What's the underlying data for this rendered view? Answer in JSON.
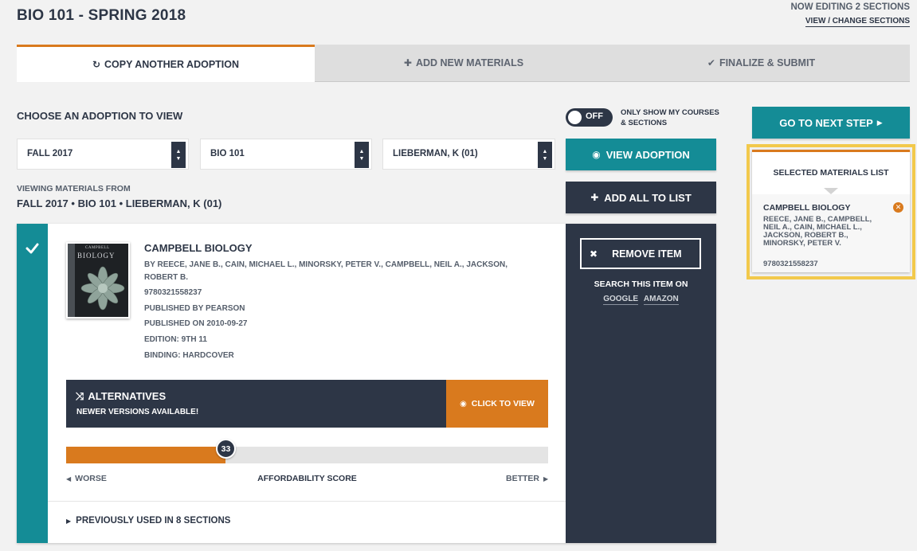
{
  "page": {
    "title": "BIO 101 - SPRING 2018",
    "editing_status": "NOW EDITING 2 SECTIONS",
    "change_sections_link": "VIEW / CHANGE SECTIONS"
  },
  "tabs": [
    {
      "label": "COPY ANOTHER ADOPTION",
      "icon": "refresh-icon",
      "active": true
    },
    {
      "label": "ADD NEW MATERIALS",
      "icon": "plus-icon",
      "active": false
    },
    {
      "label": "FINALIZE & SUBMIT",
      "icon": "check-icon",
      "active": false
    }
  ],
  "chooser": {
    "heading": "CHOOSE AN ADOPTION TO VIEW",
    "toggle_state": "OFF",
    "toggle_label": "ONLY SHOW MY COURSES & SECTIONS",
    "term_select": "FALL 2017",
    "course_select": "BIO 101",
    "instructor_select": "LIEBERMAN, K (01)",
    "view_button": "VIEW ADOPTION",
    "add_all_button": "ADD ALL TO LIST"
  },
  "viewing": {
    "label": "VIEWING MATERIALS FROM",
    "value": "FALL 2017 • BIO 101 • LIEBERMAN, K (01)"
  },
  "item": {
    "title": "CAMPBELL BIOLOGY",
    "cover_text": "BIOLOGY",
    "cover_small_text": "CAMPBELL",
    "authors": "BY REECE, JANE B., CAIN, MICHAEL L., MINORSKY, PETER V., CAMPBELL, NEIL A., JACKSON,",
    "authors_cont": "ROBERT B.",
    "isbn": "9780321558237",
    "publisher": "PUBLISHED BY PEARSON",
    "published_on": "PUBLISHED ON 2010-09-27",
    "edition": "EDITION: 9TH 11",
    "binding": "BINDING: HARDCOVER",
    "alternatives_title": "ALTERNATIVES",
    "alternatives_sub": "NEWER VERSIONS AVAILABLE!",
    "alternatives_button": "CLICK TO VIEW",
    "score_value": "33",
    "score_fraction": 0.33,
    "score_worse": "WORSE",
    "score_label": "AFFORDABILITY SCORE",
    "score_better": "BETTER",
    "previously_used": "PREVIOUSLY USED IN 8 SECTIONS",
    "remove_button": "REMOVE ITEM",
    "search_on": "SEARCH THIS ITEM ON",
    "google_link": "GOOGLE",
    "amazon_link": "AMAZON"
  },
  "next_step": {
    "label": "GO TO NEXT STEP"
  },
  "selected_list": {
    "heading": "SELECTED MATERIALS LIST",
    "item_title": "CAMPBELL BIOLOGY",
    "item_authors": "REECE, JANE B., CAMPBELL, NEIL A., CAIN, MICHAEL L., JACKSON, ROBERT B., MINORSKY, PETER V.",
    "item_isbn": "9780321558237"
  },
  "colors": {
    "teal": "#148c96",
    "navy": "#2d3646",
    "orange": "#d97a1e",
    "highlight": "#f2c94c"
  }
}
